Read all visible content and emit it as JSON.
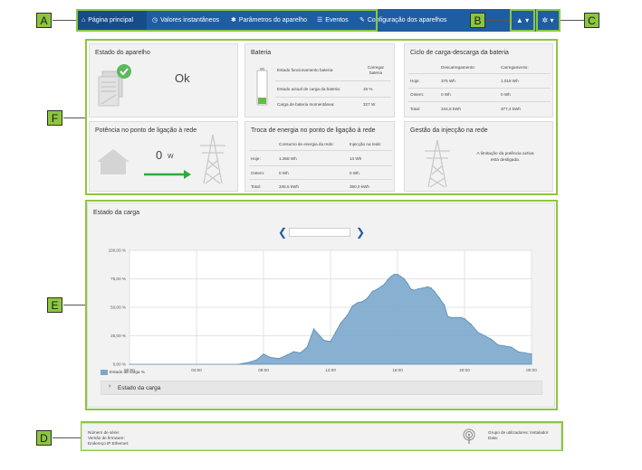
{
  "nav": {
    "items": [
      {
        "icon": "home-icon",
        "glyph": "⌂",
        "label": "Página principal"
      },
      {
        "icon": "clock-icon",
        "glyph": "◷",
        "label": "Valores instantâneos"
      },
      {
        "icon": "gear-icon",
        "glyph": "✱",
        "label": "Parâmetros do aparelho"
      },
      {
        "icon": "list-icon",
        "glyph": "☰",
        "label": "Eventos"
      },
      {
        "icon": "wrench-icon",
        "glyph": "✎",
        "label": "Configuração dos aparelhos"
      }
    ],
    "user_glyph": "▲ ▾",
    "settings_glyph": "✲ ▾"
  },
  "callouts": {
    "a": "A",
    "b": "B",
    "c": "C",
    "d": "D",
    "e": "E",
    "f": "F"
  },
  "device_state": {
    "title": "Estado do aparelho",
    "value": "Ok"
  },
  "battery": {
    "title": "Bateria",
    "rows": [
      {
        "label": "Estado funcionamento bateria:",
        "value": "Carregar bateria"
      },
      {
        "label": "Estado actual de carga da bateria:",
        "value": "15 %"
      },
      {
        "label": "Carga de bateria momentânea:",
        "value": "327 W"
      }
    ]
  },
  "cycle": {
    "title": "Ciclo de carga-descarga da bateria",
    "headers": [
      "Descarregamento:",
      "Carregamento:"
    ],
    "rows": [
      {
        "label": "Hoje:",
        "discharge": "375 Wh",
        "charge": "1.018 Wh"
      },
      {
        "label": "Ontem:",
        "discharge": "0 Wh",
        "charge": "0 Wh"
      },
      {
        "label": "Total:",
        "discharge": "344,6 kWh",
        "charge": "377,4 kWh"
      }
    ]
  },
  "grid_power": {
    "title": "Potência no ponto de ligação à rede",
    "value": "0",
    "unit": "W"
  },
  "exchange": {
    "title": "Troca de energia no ponto de ligação à rede",
    "headers": [
      "Consumo de energia da rede:",
      "Injecção na rede:"
    ],
    "rows": [
      {
        "label": "Hoje:",
        "consumption": "1.366 Wh",
        "feed": "14 Wh"
      },
      {
        "label": "Ontem:",
        "consumption": "0 Wh",
        "feed": "0 Wh"
      },
      {
        "label": "Total:",
        "consumption": "345,5 kWh",
        "feed": "360,0 kWh"
      }
    ]
  },
  "feed_mgmt": {
    "title": "Gestão da injecção na rede",
    "message": "A limitação da potência activa está desligada."
  },
  "chart_panel": {
    "title": "Estado da carga",
    "collapse_label": "Estado da carga"
  },
  "chart_data": {
    "type": "area",
    "x_ticks": [
      "00:00",
      "04:00",
      "08:00",
      "12:00",
      "16:00",
      "20:00",
      "00:00"
    ],
    "y_ticks": [
      "0,00 %",
      "25,00 %",
      "50,00 %",
      "75,00 %",
      "100,00 %"
    ],
    "ylim": [
      0,
      100
    ],
    "xlim": [
      0,
      24
    ],
    "grid": true,
    "legend_position": "bottom-left",
    "series": [
      {
        "name": "Estado da carga %",
        "color": "#7ba7cc",
        "x": [
          0,
          6.5,
          7.2,
          7.6,
          8.0,
          8.4,
          8.9,
          9.4,
          9.8,
          10.2,
          10.6,
          11.0,
          11.6,
          12.0,
          12.3,
          12.6,
          13.0,
          13.3,
          13.6,
          13.9,
          14.2,
          14.5,
          14.8,
          15.0,
          15.2,
          15.4,
          15.6,
          15.8,
          16.0,
          16.2,
          16.4,
          16.6,
          16.8,
          17.0,
          17.2,
          17.5,
          17.8,
          18.0,
          18.2,
          18.5,
          18.8,
          19.0,
          19.2,
          19.5,
          19.8,
          20.0,
          20.4,
          20.8,
          21.2,
          21.6,
          22.0,
          22.4,
          22.8,
          23.2,
          23.6,
          24.0
        ],
        "y": [
          0,
          0,
          2,
          4,
          9,
          6,
          5,
          8,
          11,
          10,
          15,
          31,
          21,
          20,
          28,
          36,
          43,
          51,
          54,
          55,
          58,
          64,
          66,
          68,
          70,
          74,
          77,
          79,
          79,
          77,
          75,
          71,
          66,
          65,
          66,
          67,
          68,
          67,
          64,
          58,
          52,
          42,
          41,
          41,
          41,
          40,
          35,
          28,
          25,
          22,
          17,
          16,
          15,
          11,
          10,
          9
        ]
      }
    ]
  },
  "footer": {
    "serial_label": "Número de série:",
    "firmware_label": "Versão de firmware:",
    "ip_label": "Endereço IP Ethernet:",
    "user_group": "Grupo de utilizadores: Instalador",
    "date_label": "Data:"
  }
}
